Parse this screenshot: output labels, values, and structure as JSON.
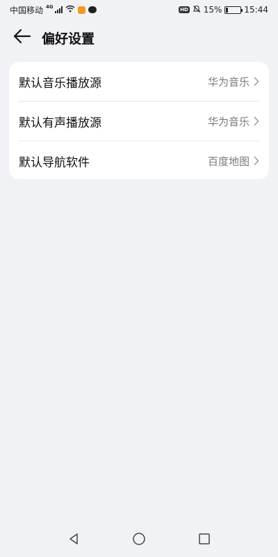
{
  "status_bar": {
    "carrier": "中国移动",
    "network_type": "4G",
    "battery_percent": "15%",
    "battery_level": 0.15,
    "time": "15:44",
    "hd_label": "HD",
    "icons": [
      "signal-icon",
      "wifi-icon",
      "app-notification-icon",
      "message-icon",
      "hd-icon",
      "mute-icon",
      "battery-icon"
    ]
  },
  "header": {
    "title": "偏好设置",
    "back_icon": "arrow-left-icon"
  },
  "settings": {
    "items": [
      {
        "label": "默认音乐播放源",
        "value": "华为音乐"
      },
      {
        "label": "默认有声播放源",
        "value": "华为音乐"
      },
      {
        "label": "默认导航软件",
        "value": "百度地图"
      }
    ]
  },
  "nav_bar": {
    "icons": [
      "back-triangle-icon",
      "home-circle-icon",
      "recents-square-icon"
    ]
  },
  "colors": {
    "background": "#f1f2f5",
    "card": "#ffffff",
    "value_text": "#7a7a7a"
  }
}
